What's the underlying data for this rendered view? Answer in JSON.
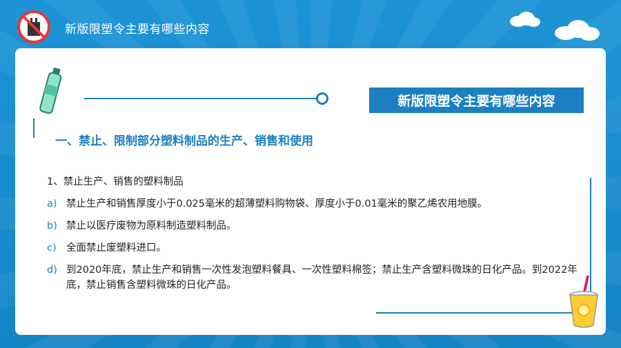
{
  "header": {
    "title": "新版限塑令主要有哪些内容"
  },
  "panel": {
    "title": "新版限塑令主要有哪些内容",
    "section_heading": "一、禁止、限制部分塑料制品的生产、销售和使用",
    "subhead": "1、禁止生产、销售的塑料制品",
    "items": [
      {
        "marker": "a)",
        "text": "禁止生产和销售厚度小于0.025毫米的超薄塑料购物袋、厚度小于0.01毫米的聚乙烯农用地膜。"
      },
      {
        "marker": "b)",
        "text": "禁止以医疗废物为原料制造塑料制品。"
      },
      {
        "marker": "c)",
        "text": "全面禁止废塑料进口。"
      },
      {
        "marker": "d)",
        "text": "到2020年底，禁止生产和销售一次性发泡塑料餐具、一次性塑料棉签；禁止生产含塑料微珠的日化产品。到2022年底，禁止销售含塑料微珠的日化产品。"
      }
    ]
  },
  "colors": {
    "accent": "#1b7fc2",
    "background": "#1a8fd1"
  },
  "icons": [
    "no-plastic-bag-icon",
    "water-bottle-icon",
    "juice-cup-icon",
    "cloud-icon"
  ]
}
